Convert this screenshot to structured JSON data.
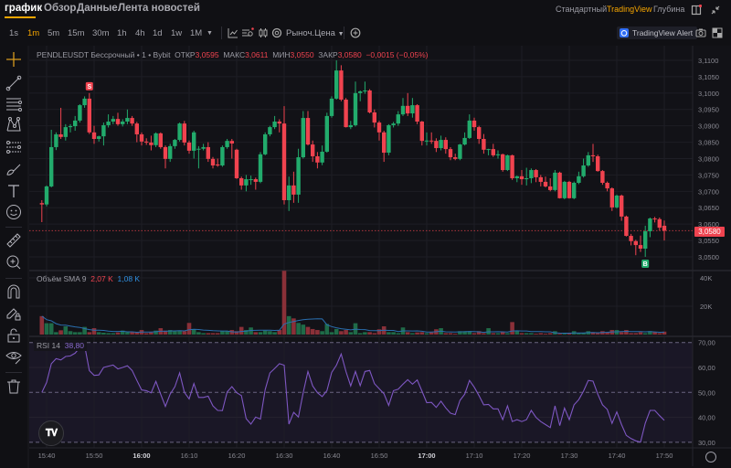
{
  "header": {
    "tabs": [
      {
        "label": "график",
        "active": true
      },
      {
        "label": "Обзор",
        "active": false
      },
      {
        "label": "Данные",
        "active": false
      },
      {
        "label": "Лента новостей",
        "active": false
      }
    ],
    "view_options": [
      {
        "label": "Стандартный",
        "active": false
      },
      {
        "label": "TradingView",
        "active": true
      },
      {
        "label": "Глубина",
        "active": false
      }
    ],
    "icons": [
      "layout-icon",
      "collapse-icon"
    ]
  },
  "toolbar": {
    "intervals": [
      {
        "label": "1s",
        "active": false
      },
      {
        "label": "1m",
        "active": true
      },
      {
        "label": "5m",
        "active": false
      },
      {
        "label": "15m",
        "active": false
      },
      {
        "label": "30m",
        "active": false
      },
      {
        "label": "1h",
        "active": false
      },
      {
        "label": "4h",
        "active": false
      },
      {
        "label": "1d",
        "active": false
      },
      {
        "label": "1w",
        "active": false
      },
      {
        "label": "1M",
        "active": false
      }
    ],
    "price_type": "Рыноч.Цена",
    "alert_button": "TradingView Alert",
    "icons": [
      "indicators-icon",
      "templates-icon",
      "candle-type-icon",
      "settings-icon",
      "add-icon",
      "camera-icon",
      "fullscreen-icon"
    ]
  },
  "side_tools": [
    "crosshair-icon",
    "trend-line-icon",
    "fib-lines-icon",
    "pattern-icon",
    "prediction-icon",
    "brush-icon",
    "text-icon",
    "emoji-icon",
    "ruler-icon",
    "zoom-in-icon",
    "magnet-icon",
    "lock-drawing-icon",
    "lock-icon",
    "eye-icon",
    "trash-icon"
  ],
  "legend": {
    "symbol": "PENDLEUSDT Бессрочный • 1 • Bybit",
    "open_label": "ОТКР",
    "open": "3,0595",
    "high_label": "МАКС",
    "high": "3,0611",
    "low_label": "МИН",
    "low": "3,0550",
    "close_label": "ЗАКР",
    "close": "3,0580",
    "change": "−0,0015 (−0,05%)"
  },
  "volume_legend": {
    "label": "Объём SMA 9",
    "volume": "2,07 K",
    "sma": "1,08 K"
  },
  "rsi_legend": {
    "label": "RSI 14",
    "value": "38,80"
  },
  "last_price_badge": "3,0580",
  "logo_text": "TV",
  "colors": {
    "up": "#22ab6c",
    "down": "#f0434f",
    "rsi": "#7e57c2",
    "sma": "#2a6fb0",
    "accent": "#f7a600",
    "background": "#111116"
  },
  "markers": [
    {
      "label": "S",
      "candle": 10,
      "type": "sell"
    },
    {
      "label": "B",
      "candle": 127,
      "type": "buy"
    }
  ],
  "chart_data": {
    "type": "candlestick",
    "interval": "1m",
    "price_ticks": [
      "3,1100",
      "3,1050",
      "3,1000",
      "3,0950",
      "3,0900",
      "3,0850",
      "3,0800",
      "3,0750",
      "3,0700",
      "3,0650",
      "3,0600",
      "3,0550",
      "3,0500"
    ],
    "price_ylim": [
      3.0478,
      3.1148
    ],
    "volume_ticks": [
      "40K",
      "20K"
    ],
    "rsi_ticks": [
      "70,00",
      "60,00",
      "50,00",
      "40,00",
      "30,00"
    ],
    "time_ticks": [
      {
        "label": "15:40",
        "bold": false
      },
      {
        "label": "15:50",
        "bold": false
      },
      {
        "label": "16:00",
        "bold": true
      },
      {
        "label": "16:10",
        "bold": false
      },
      {
        "label": "16:20",
        "bold": false
      },
      {
        "label": "16:30",
        "bold": false
      },
      {
        "label": "16:40",
        "bold": false
      },
      {
        "label": "16:50",
        "bold": false
      },
      {
        "label": "17:00",
        "bold": true
      },
      {
        "label": "17:10",
        "bold": false
      },
      {
        "label": "17:20",
        "bold": false
      },
      {
        "label": "17:30",
        "bold": false
      },
      {
        "label": "17:40",
        "bold": false
      },
      {
        "label": "17:50",
        "bold": false
      }
    ],
    "candles_ohlc": [
      [
        3.0664,
        3.0673,
        3.0606,
        3.066
      ],
      [
        3.066,
        3.0718,
        3.0654,
        3.0715
      ],
      [
        3.0715,
        3.0888,
        3.0712,
        3.0835
      ],
      [
        3.0835,
        3.088,
        3.0826,
        3.0874
      ],
      [
        3.0874,
        3.0955,
        3.086,
        3.0866
      ],
      [
        3.0866,
        3.0905,
        3.0855,
        3.0896
      ],
      [
        3.0896,
        3.0905,
        3.088,
        3.0899
      ],
      [
        3.0899,
        3.093,
        3.0885,
        3.0916
      ],
      [
        3.0916,
        3.0966,
        3.091,
        3.0963
      ],
      [
        3.0963,
        3.099,
        3.0955,
        3.0983
      ],
      [
        3.0983,
        3.1,
        3.0875,
        3.088
      ],
      [
        3.088,
        3.09,
        3.0845,
        3.086
      ],
      [
        3.086,
        3.087,
        3.0852,
        3.0868
      ],
      [
        3.0868,
        3.091,
        3.084,
        3.0902
      ],
      [
        3.0902,
        3.0935,
        3.0895,
        3.0913
      ],
      [
        3.0913,
        3.093,
        3.0905,
        3.0921
      ],
      [
        3.0921,
        3.094,
        3.09,
        3.0905
      ],
      [
        3.0905,
        3.092,
        3.0898,
        3.0913
      ],
      [
        3.0913,
        3.095,
        3.0905,
        3.0924
      ],
      [
        3.0924,
        3.093,
        3.09,
        3.0907
      ],
      [
        3.0907,
        3.0912,
        3.085,
        3.0874
      ],
      [
        3.0874,
        3.088,
        3.084,
        3.0852
      ],
      [
        3.0852,
        3.0862,
        3.0842,
        3.0849
      ],
      [
        3.0849,
        3.087,
        3.0825,
        3.0841
      ],
      [
        3.0841,
        3.088,
        3.0835,
        3.0877
      ],
      [
        3.0877,
        3.088,
        3.083,
        3.0835
      ],
      [
        3.0835,
        3.084,
        3.077,
        3.0799
      ],
      [
        3.0799,
        3.0845,
        3.079,
        3.0838
      ],
      [
        3.0838,
        3.086,
        3.083,
        3.0857
      ],
      [
        3.0857,
        3.091,
        3.0852,
        3.0907
      ],
      [
        3.0907,
        3.0915,
        3.084,
        3.0849
      ],
      [
        3.0849,
        3.0855,
        3.0815,
        3.0824
      ],
      [
        3.0824,
        3.0885,
        3.08,
        3.088
      ],
      [
        3.0829,
        3.0838,
        3.077,
        3.083
      ],
      [
        3.083,
        3.0845,
        3.0825,
        3.0835
      ],
      [
        3.0835,
        3.085,
        3.079,
        3.0799
      ],
      [
        3.0799,
        3.0805,
        3.077,
        3.0779
      ],
      [
        3.0782,
        3.08,
        3.0775,
        3.0779
      ],
      [
        3.0779,
        3.084,
        3.0775,
        3.0835
      ],
      [
        3.0835,
        3.086,
        3.083,
        3.0854
      ],
      [
        3.0854,
        3.086,
        3.08,
        3.0846
      ],
      [
        3.0827,
        3.083,
        3.0738,
        3.074
      ],
      [
        3.074,
        3.0745,
        3.0705,
        3.0718
      ],
      [
        3.0718,
        3.075,
        3.07,
        3.0737
      ],
      [
        3.0737,
        3.0748,
        3.072,
        3.0737
      ],
      [
        3.0737,
        3.0742,
        3.0705,
        3.0729
      ],
      [
        3.0729,
        3.082,
        3.0725,
        3.0813
      ],
      [
        3.0813,
        3.088,
        3.081,
        3.0874
      ],
      [
        3.0874,
        3.09,
        3.0868,
        3.0896
      ],
      [
        3.0896,
        3.093,
        3.089,
        3.0913
      ],
      [
        3.0913,
        3.092,
        3.088,
        3.0907
      ],
      [
        3.0907,
        3.096,
        3.066,
        3.0673
      ],
      [
        3.0673,
        3.0745,
        3.064,
        3.0718
      ],
      [
        3.0718,
        3.076,
        3.0665,
        3.069
      ],
      [
        3.069,
        3.083,
        3.0665,
        3.0804
      ],
      [
        3.0804,
        3.0945,
        3.08,
        3.0924
      ],
      [
        3.0924,
        3.0945,
        3.084,
        3.0843
      ],
      [
        3.0843,
        3.0855,
        3.079,
        3.0807
      ],
      [
        3.0807,
        3.082,
        3.077,
        3.0788
      ],
      [
        3.0788,
        3.084,
        3.078,
        3.0821
      ],
      [
        3.0821,
        3.094,
        3.0818,
        3.093
      ],
      [
        3.093,
        3.099,
        3.0925,
        3.0983
      ],
      [
        3.0983,
        3.11,
        3.098,
        3.1069
      ],
      [
        3.1069,
        3.1085,
        3.0975,
        3.098
      ],
      [
        3.098,
        3.0985,
        3.0895,
        3.0896
      ],
      [
        3.0896,
        3.0915,
        3.089,
        3.0902
      ],
      [
        3.0902,
        3.1035,
        3.0898,
        3.1
      ],
      [
        3.1,
        3.1008,
        3.0975,
        3.1005
      ],
      [
        3.1005,
        3.1035,
        3.0998,
        3.1008
      ],
      [
        3.1008,
        3.1012,
        3.0938,
        3.0941
      ],
      [
        3.0941,
        3.095,
        3.0895,
        3.091
      ],
      [
        3.091,
        3.0915,
        3.0855,
        3.088
      ],
      [
        3.088,
        3.0885,
        3.079,
        3.0818
      ],
      [
        3.0818,
        3.0905,
        3.081,
        3.0902
      ],
      [
        3.0902,
        3.0912,
        3.0895,
        3.0907
      ],
      [
        3.0907,
        3.0945,
        3.09,
        3.0935
      ],
      [
        3.0935,
        3.0985,
        3.093,
        3.0961
      ],
      [
        3.0961,
        3.1,
        3.093,
        3.0938
      ],
      [
        3.0938,
        3.0985,
        3.0925,
        3.0963
      ],
      [
        3.0963,
        3.0966,
        3.0905,
        3.0913
      ],
      [
        3.0913,
        3.0915,
        3.084,
        3.0854
      ],
      [
        3.0854,
        3.088,
        3.084,
        3.0855
      ],
      [
        3.0855,
        3.088,
        3.0845,
        3.0854
      ],
      [
        3.0854,
        3.0862,
        3.082,
        3.0832
      ],
      [
        3.0832,
        3.087,
        3.0825,
        3.0857
      ],
      [
        3.0857,
        3.0865,
        3.0815,
        3.0829
      ],
      [
        3.0829,
        3.0835,
        3.0795,
        3.0804
      ],
      [
        3.0804,
        3.0815,
        3.0795,
        3.0799
      ],
      [
        3.0799,
        3.0845,
        3.0795,
        3.0843
      ],
      [
        3.0843,
        3.088,
        3.084,
        3.0863
      ],
      [
        3.0863,
        3.0935,
        3.086,
        3.0916
      ],
      [
        3.0916,
        3.0925,
        3.0885,
        3.0896
      ],
      [
        3.0896,
        3.09,
        3.0845,
        3.086
      ],
      [
        3.086,
        3.0875,
        3.0815,
        3.0827
      ],
      [
        3.0827,
        3.083,
        3.081,
        3.0829
      ],
      [
        3.0829,
        3.0845,
        3.0805,
        3.081
      ],
      [
        3.081,
        3.0825,
        3.08,
        3.0813
      ],
      [
        3.0813,
        3.0815,
        3.076,
        3.0765
      ],
      [
        3.0765,
        3.0812,
        3.0762,
        3.081
      ],
      [
        3.081,
        3.0812,
        3.0735,
        3.074
      ],
      [
        3.074,
        3.0748,
        3.0728,
        3.0746
      ],
      [
        3.0746,
        3.0765,
        3.072,
        3.0737
      ],
      [
        3.0737,
        3.0772,
        3.0718,
        3.074
      ],
      [
        3.074,
        3.077,
        3.0725,
        3.0765
      ],
      [
        3.0765,
        3.0768,
        3.0728,
        3.0743
      ],
      [
        3.0743,
        3.075,
        3.0715,
        3.0729
      ],
      [
        3.0729,
        3.0745,
        3.0712,
        3.0715
      ],
      [
        3.0715,
        3.074,
        3.07,
        3.0704
      ],
      [
        3.0704,
        3.0765,
        3.07,
        3.0757
      ],
      [
        3.0757,
        3.076,
        3.0678,
        3.0679
      ],
      [
        3.0679,
        3.0732,
        3.0676,
        3.0729
      ],
      [
        3.0729,
        3.0732,
        3.0678,
        3.0679
      ],
      [
        3.0679,
        3.073,
        3.0676,
        3.0726
      ],
      [
        3.0726,
        3.076,
        3.0722,
        3.0746
      ],
      [
        3.0746,
        3.08,
        3.0742,
        3.0779
      ],
      [
        3.0779,
        3.082,
        3.0775,
        3.081
      ],
      [
        3.081,
        3.0845,
        3.079,
        3.0807
      ],
      [
        3.0807,
        3.0812,
        3.076,
        3.0762
      ],
      [
        3.0762,
        3.0765,
        3.072,
        3.0726
      ],
      [
        3.0726,
        3.073,
        3.07,
        3.0709
      ],
      [
        3.0709,
        3.0712,
        3.064,
        3.0651
      ],
      [
        3.0651,
        3.069,
        3.0648,
        3.0687
      ],
      [
        3.0687,
        3.069,
        3.061,
        3.0623
      ],
      [
        3.0623,
        3.0626,
        3.0562,
        3.0564
      ],
      [
        3.0564,
        3.057,
        3.0535,
        3.0548
      ],
      [
        3.0548,
        3.0552,
        3.0505,
        3.0536
      ],
      [
        3.0536,
        3.0565,
        3.0515,
        3.0525
      ],
      [
        3.0525,
        3.0595,
        3.05,
        3.0578
      ],
      [
        3.0578,
        3.062,
        3.056,
        3.0617
      ],
      [
        3.0617,
        3.0622,
        3.0605,
        3.0615
      ],
      [
        3.0615,
        3.062,
        3.058,
        3.0589
      ],
      [
        3.0595,
        3.0611,
        3.055,
        3.058
      ]
    ],
    "volume_k": [
      13,
      8,
      8,
      1.7,
      3,
      5.8,
      2.4,
      1.7,
      1.7,
      5.4,
      1.7,
      4.5,
      1.7,
      1.3,
      1,
      1,
      1.5,
      2.8,
      1.7,
      1.7,
      1.7,
      3.2,
      1,
      1.5,
      2.8,
      4.5,
      2.8,
      3.2,
      2.4,
      2.8,
      2.4,
      8.2,
      3.9,
      1.7,
      1,
      1,
      1,
      1,
      2.4,
      2.4,
      3.2,
      2.4,
      5.4,
      3.2,
      5,
      1.7,
      1.7,
      2.8,
      2.4,
      1.7,
      3.2,
      45,
      13,
      11.4,
      8.2,
      7,
      5.4,
      3.9,
      3.2,
      2.4,
      7.5,
      1.7,
      3.9,
      2.4,
      3.2,
      1.7,
      8,
      1,
      1.7,
      1.7,
      1,
      3.7,
      5.8,
      1.7,
      1.7,
      1,
      5,
      1.7,
      1,
      1.5,
      1.7,
      1,
      1.5,
      3.7,
      4.5,
      1,
      1,
      0.6,
      2.4,
      2.4,
      2.4,
      1,
      2.4,
      1,
      4.5,
      1,
      1,
      1.7,
      1,
      8.8,
      2.4,
      1,
      1,
      1,
      0.6,
      1,
      0.6,
      1,
      2.4,
      0.6,
      0.6,
      1,
      2.4,
      1,
      1,
      2.4,
      1.7,
      1,
      2.4,
      1.7,
      3.2,
      3.2,
      1.7,
      3.2,
      1,
      1,
      1.7,
      1,
      2.4,
      1.7,
      1,
      2.07
    ],
    "volume_ylim_k": [
      0,
      46
    ],
    "rsi": [
      50,
      54,
      61.5,
      63.5,
      63,
      64.4,
      64.6,
      65.7,
      68,
      68.8,
      58.7,
      56.8,
      57,
      60,
      60.5,
      61,
      59.4,
      60,
      60.7,
      58.8,
      54.8,
      51,
      50.7,
      49.8,
      54.4,
      49.3,
      44.4,
      49.3,
      52.3,
      57.8,
      50,
      47.4,
      53.5,
      48,
      48,
      48.5,
      44.6,
      42.8,
      42.7,
      50.2,
      52.3,
      49.9,
      48.7,
      39.5,
      37.3,
      40.1,
      39.3,
      51.1,
      57.8,
      59.6,
      61.5,
      60.9,
      37.3,
      42,
      40.1,
      49.9,
      58.4,
      52.6,
      49.9,
      48.3,
      50.7,
      58,
      60.9,
      65.4,
      58.4,
      52.6,
      58.4,
      52.7,
      58.4,
      58.8,
      53.5,
      51.5,
      49.5,
      44.8,
      50.7,
      51.3,
      53.3,
      55.1,
      53.3,
      55,
      50.5,
      45.9,
      46,
      44,
      46.5,
      43.8,
      41.7,
      41.1,
      46.8,
      49.3,
      54.8,
      52.1,
      48.7,
      45,
      45.2,
      43.4,
      43.4,
      39.1,
      44.6,
      38.3,
      39.1,
      38.3,
      39.1,
      42.8,
      40,
      38.3,
      37.1,
      35.9,
      44.6,
      36.7,
      43.7,
      39.1,
      45,
      47.1,
      50.5,
      54.8,
      54.5,
      49.3,
      45,
      43.2,
      37.6,
      42.2,
      37.1,
      32.8,
      31.5,
      30.6,
      30.1,
      37.7,
      42.8,
      42.8,
      40.7,
      38.8
    ],
    "rsi_ylim": [
      30,
      70
    ],
    "rsi_bands": [
      70,
      50,
      30
    ],
    "volume_sma_period": 9,
    "grid": true
  }
}
